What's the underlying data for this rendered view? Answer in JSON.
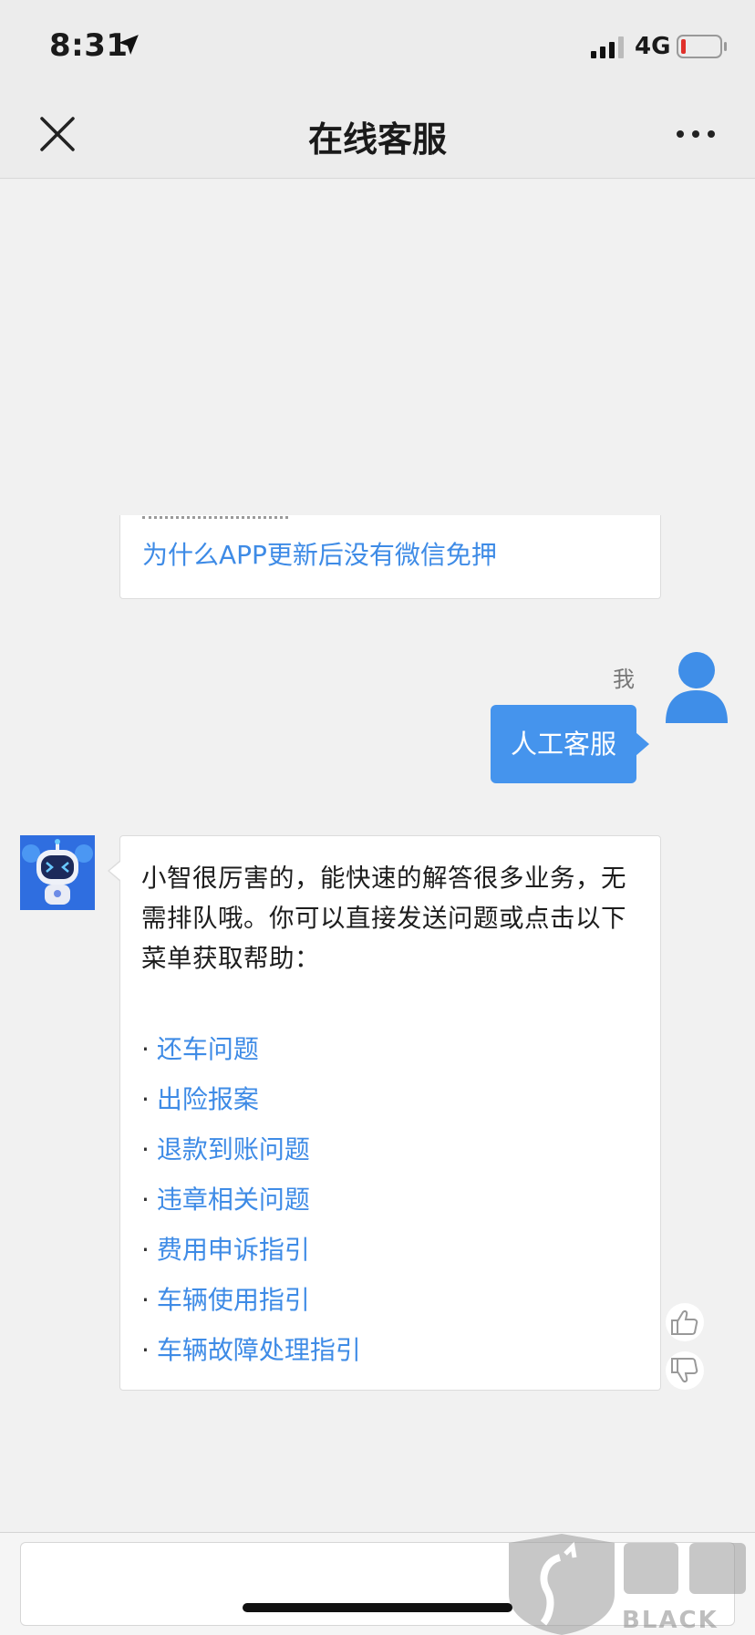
{
  "status_bar": {
    "time": "8:31",
    "network": "4G"
  },
  "nav": {
    "title": "在线客服"
  },
  "previous_message": {
    "link": "为什么APP更新后没有微信免押"
  },
  "user_message": {
    "sender_label": "我",
    "text": "人工客服"
  },
  "bot_message": {
    "intro": "小智很厉害的，能快速的解答很多业务，无需排队哦。你可以直接发送问题或点击以下菜单获取帮助：",
    "bullet": "·",
    "menu_items": [
      "还车问题",
      "出险报案",
      "退款到账问题",
      "违章相关问题",
      "费用申诉指引",
      "车辆使用指引",
      "车辆故障处理指引"
    ]
  },
  "watermark": {
    "text": "BLACK CAT"
  },
  "colors": {
    "link": "#3e8be6",
    "bubble": "#4594ed",
    "background": "#f1f1f1"
  },
  "icons": [
    "location-arrow-icon",
    "signal-icon",
    "battery-low-icon",
    "close-icon",
    "more-icon",
    "user-avatar-icon",
    "robot-avatar-icon",
    "thumbs-up-icon",
    "thumbs-down-icon"
  ]
}
